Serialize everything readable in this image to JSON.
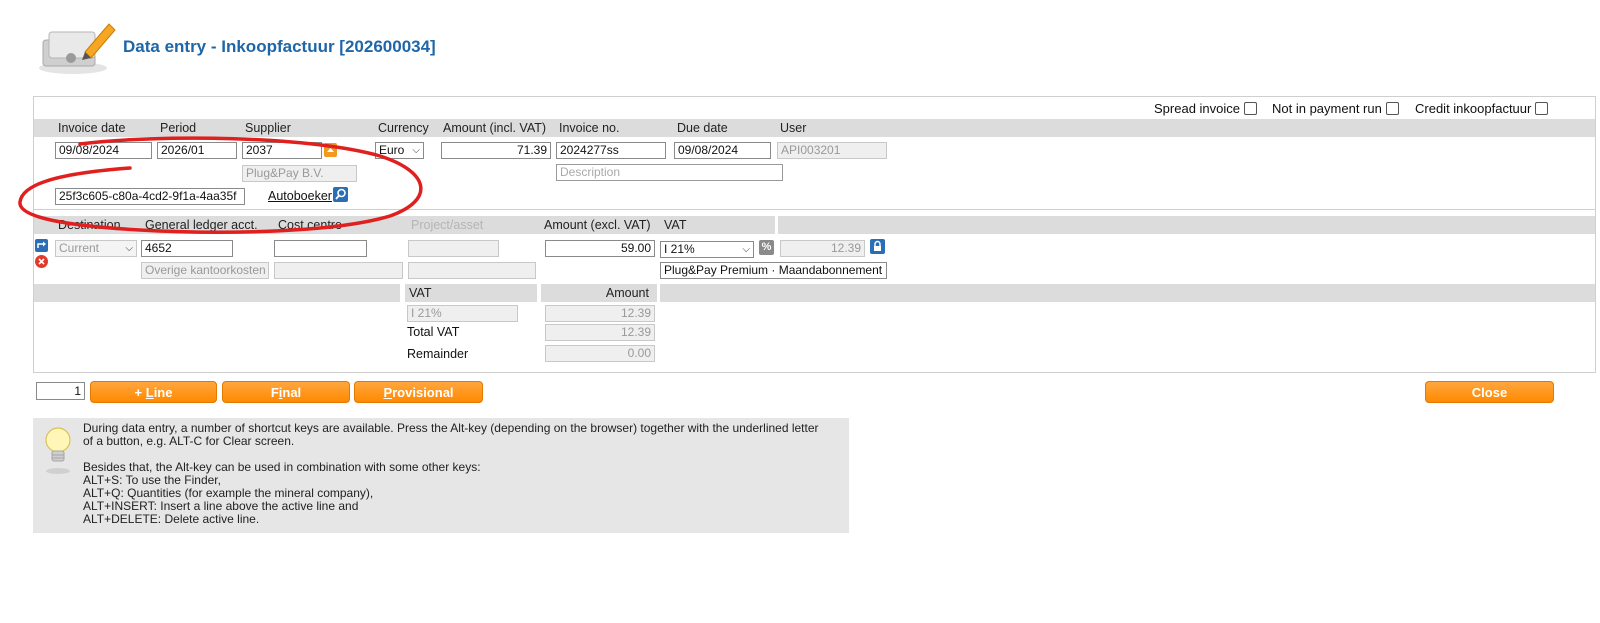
{
  "title": "Data entry - Inkoopfactuur [202600034]",
  "options": {
    "spread_invoice": "Spread invoice",
    "not_in_payment_run": "Not in payment run",
    "credit_inkoopfactuur": "Credit inkoopfactuur"
  },
  "header_cols": {
    "invoice_date": "Invoice date",
    "period": "Period",
    "supplier": "Supplier",
    "currency": "Currency",
    "amount_incl_vat": "Amount (incl. VAT)",
    "invoice_no": "Invoice no.",
    "due_date": "Due date",
    "user": "User"
  },
  "header_values": {
    "invoice_date": "09/08/2024",
    "period": "2026/01",
    "supplier_code": "2037",
    "supplier_name": "Plug&Pay B.V.",
    "currency": "Euro",
    "amount_incl_vat": "71.39",
    "invoice_no": "2024277ss",
    "due_date": "09/08/2024",
    "user": "API003201",
    "description_placeholder": "Description",
    "guid": "25f3c605-c80a-4cd2-9f1a-4aa35f",
    "autoboeker": "Autoboeker"
  },
  "line_cols": {
    "destination": "Destination",
    "gl_acct": "General ledger acct.",
    "cost_centre": "Cost centre",
    "project_asset": "Project/asset",
    "amount_excl_vat": "Amount (excl. VAT)",
    "vat": "VAT"
  },
  "line_values": {
    "destination": "Current",
    "gl_acct": "4652",
    "gl_acct_name": "Overige kantoorkosten",
    "cost_centre": "",
    "amount_excl_vat": "59.00",
    "vat_code": "I 21%",
    "vat_amount": "12.39",
    "line_description": "Plug&Pay Premium · Maandabonnement"
  },
  "vat_summary": {
    "vat_label": "VAT",
    "amount_label": "Amount",
    "rows": [
      {
        "label": "I 21%",
        "amount": "12.39"
      }
    ],
    "total_vat_label": "Total VAT",
    "total_vat": "12.39",
    "remainder_label": "Remainder",
    "remainder": "0.00"
  },
  "actions": {
    "line_count": "1",
    "line_plus": "+ ",
    "line_u": "L",
    "line_rest": "ine",
    "final_pre": "F",
    "final_u": "i",
    "final_rest": "nal",
    "prov_u": "P",
    "prov_rest": "rovisional",
    "close": "Close"
  },
  "hint": {
    "line1": "During data entry, a number of shortcut keys are available. Press the Alt-key (depending on the browser) together with the underlined letter",
    "line2": "of a button, e.g. ALT-C for Clear screen.",
    "line3": "Besides that, the Alt-key can be used in combination with some other keys:",
    "line4": "ALT+S: To use the Finder,",
    "line5": "ALT+Q: Quantities (for example the mineral company),",
    "line6": "ALT+INSERT: Insert a line above the active line and",
    "line7": "ALT+DELETE: Delete active line."
  },
  "colors": {
    "title": "#1f66a8",
    "button": "#ff8a00",
    "annotation": "#e0201e"
  },
  "icons": [
    "invoice-pencil-icon",
    "supplier-lookup-icon",
    "autoboeker-search-icon",
    "insert-line-icon",
    "delete-line-icon",
    "vat-percent-icon",
    "lock-icon",
    "lightbulb-icon"
  ]
}
